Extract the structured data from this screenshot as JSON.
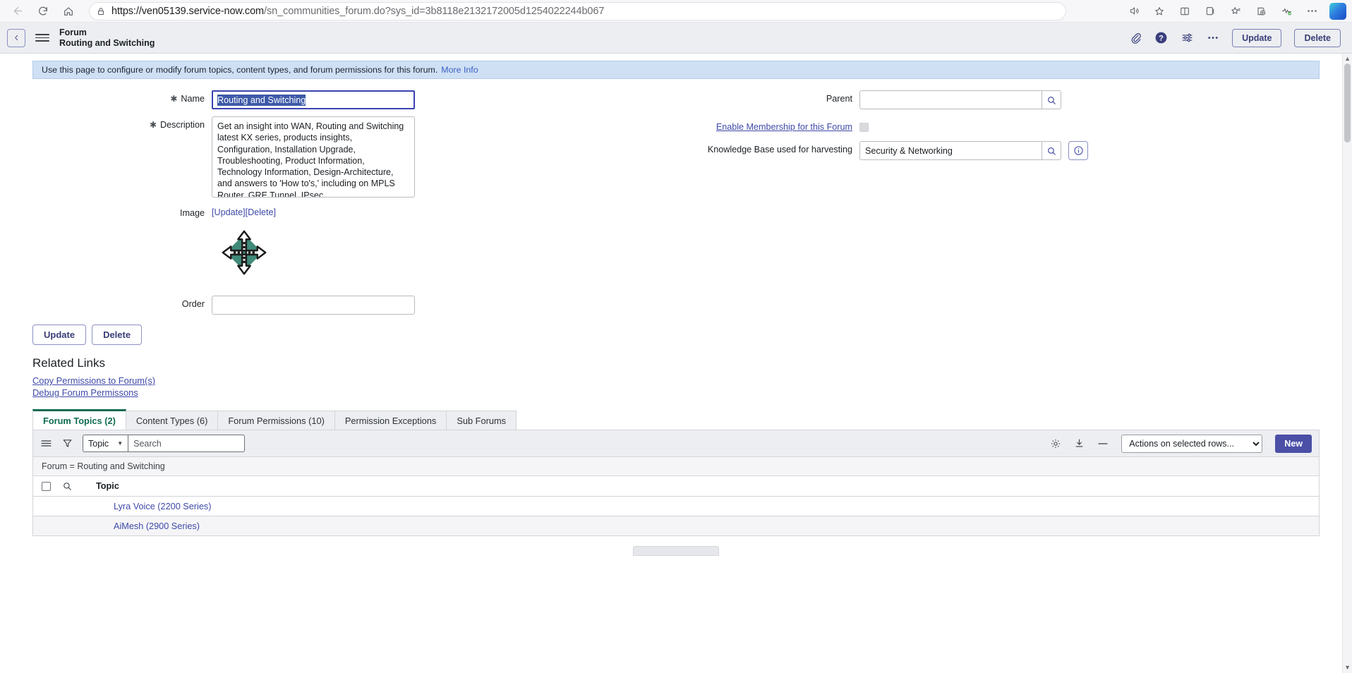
{
  "browser": {
    "url_host": "https://ven05139.service-now.com",
    "url_path": "/sn_communities_forum.do?sys_id=3b8118e2132172005d1254022244b067",
    "back_icon": "back-arrow-icon",
    "reload_icon": "reload-icon",
    "home_icon": "home-icon",
    "lock_icon": "lock-icon",
    "read_aloud_icon": "read-aloud-icon",
    "favorite_icon": "star-icon",
    "collections_icon": "collections-icon",
    "split_screen_icon": "split-screen-icon",
    "favorites_bar_icon": "favorites-icon",
    "add_tab_icon": "add-to-collection-icon",
    "browser_essentials_icon": "browser-essentials-icon",
    "settings_icon": "more-settings-icon",
    "copilot_icon": "copilot-icon"
  },
  "header": {
    "back_label": "‹",
    "menu_icon": "hamburger-menu-icon",
    "record_type": "Forum",
    "record_name": "Routing and Switching",
    "attachment_icon": "paperclip-icon",
    "help_icon": "help-icon",
    "personalize_icon": "personalize-form-icon",
    "more_icon": "more-options-icon",
    "update_label": "Update",
    "delete_label": "Delete"
  },
  "banner": {
    "text": "Use this page to configure or modify forum topics, content types, and forum permissions for this forum.",
    "link": "More Info"
  },
  "form": {
    "name": {
      "label": "Name",
      "required_marker": "✱",
      "value": "Routing and Switching"
    },
    "description": {
      "label": "Description",
      "required_marker": "✱",
      "value": "Get an insight into WAN, Routing and Switching latest KX series, products insights, Configuration, Installation Upgrade, Troubleshooting, Product Information, Technology Information, Design-Architecture, and answers to 'How to's,' including on MPLS Router, GRE Tunnel, IPsec."
    },
    "image": {
      "label": "Image",
      "update_link": "[Update]",
      "delete_link": "[Delete]",
      "icon_name": "four-way-arrow-diamond-icon",
      "icon_color": "#3f8a78"
    },
    "order": {
      "label": "Order",
      "value": "",
      "placeholder": ""
    },
    "parent": {
      "label": "Parent",
      "value": "",
      "lookup_icon": "magnifier-icon"
    },
    "membership": {
      "label": "Enable Membership for this Forum",
      "checked": false
    },
    "knowledge_base": {
      "label": "Knowledge Base used for harvesting",
      "value": "Security & Networking",
      "lookup_icon": "magnifier-icon",
      "info_icon": "info-circle-icon"
    }
  },
  "form_buttons": {
    "update_label": "Update",
    "delete_label": "Delete"
  },
  "related_links": {
    "heading": "Related Links",
    "items": [
      {
        "label": "Copy Permissions to Forum(s)"
      },
      {
        "label": "Debug Forum Permissons"
      }
    ]
  },
  "tabs": [
    {
      "label": "Forum Topics (2)",
      "active": true
    },
    {
      "label": "Content Types (6)",
      "active": false
    },
    {
      "label": "Forum Permissions (10)",
      "active": false
    },
    {
      "label": "Permission Exceptions",
      "active": false
    },
    {
      "label": "Sub Forums",
      "active": false
    }
  ],
  "list_toolbar": {
    "menu_icon": "list-menu-icon",
    "filter_icon": "filter-funnel-icon",
    "field_selector": "Topic",
    "chevron_icon": "chevron-down-icon",
    "search_placeholder": "Search",
    "search_value": "",
    "gear_icon": "gear-icon",
    "download_icon": "download-icon",
    "collapse_icon": "minus-icon",
    "actions_label": "Actions on selected rows...",
    "new_label": "New"
  },
  "list": {
    "breadcrumb": "Forum = Routing and Switching",
    "select_all_icon": "checkbox-icon",
    "search_row_icon": "magnifier-icon",
    "columns": [
      "Topic"
    ],
    "rows": [
      {
        "topic": "Lyra Voice (2200 Series)"
      },
      {
        "topic": "AiMesh (2900 Series)"
      }
    ]
  }
}
